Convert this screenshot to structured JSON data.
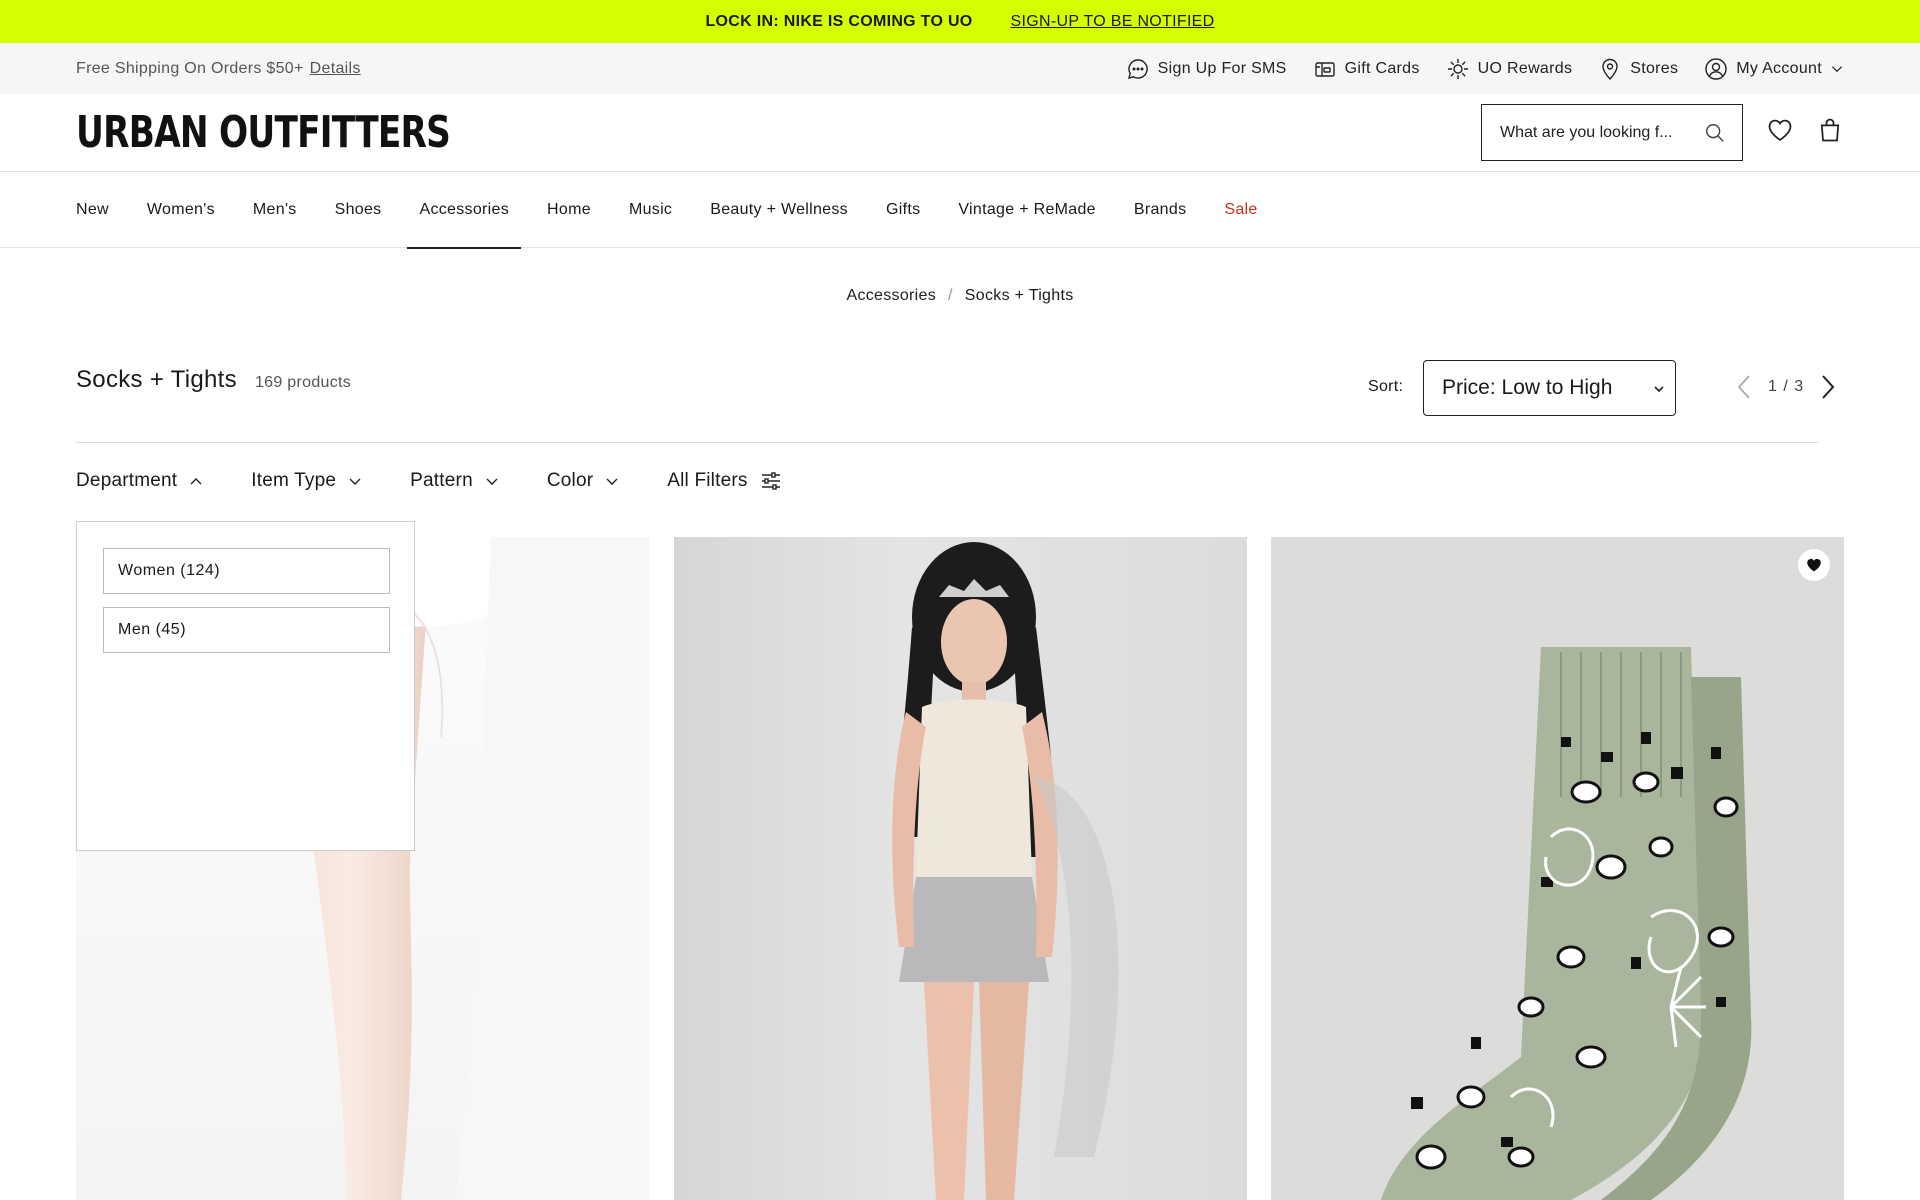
{
  "promo": {
    "headline": "LOCK IN: NIKE IS COMING TO UO",
    "link": "SIGN-UP TO BE NOTIFIED",
    "background": "#d5ff00"
  },
  "utility": {
    "shipping_text": "Free Shipping On Orders $50+",
    "details_link": "Details",
    "links": [
      {
        "label": "Sign Up For SMS",
        "icon": "chat-bubble-icon"
      },
      {
        "label": "Gift Cards",
        "icon": "gift-card-icon"
      },
      {
        "label": "UO Rewards",
        "icon": "sparkle-icon"
      },
      {
        "label": "Stores",
        "icon": "location-pin-icon"
      },
      {
        "label": "My Account",
        "icon": "user-circle-icon"
      }
    ]
  },
  "header": {
    "logo": "URBAN OUTFITTERS",
    "search_placeholder": "What are you looking f...",
    "icons": [
      "heart-icon",
      "bag-icon"
    ]
  },
  "nav": {
    "items": [
      "New",
      "Women's",
      "Men's",
      "Shoes",
      "Accessories",
      "Home",
      "Music",
      "Beauty + Wellness",
      "Gifts",
      "Vintage + ReMade",
      "Brands",
      "Sale"
    ],
    "active": "Accessories",
    "sale_color": "#c8321b"
  },
  "breadcrumb": {
    "items": [
      "Accessories",
      "Socks + Tights"
    ],
    "separator": "/"
  },
  "listing": {
    "title": "Socks + Tights",
    "count": "169 products",
    "sort_label": "Sort:",
    "sort_value": "Price: Low to High",
    "page_current": "1",
    "page_sep": "/",
    "page_total": "3"
  },
  "filters": {
    "items": [
      "Department",
      "Item Type",
      "Pattern",
      "Color",
      "All Filters"
    ],
    "open": "Department"
  },
  "department_dropdown": {
    "options": [
      "Women (124)",
      "Men (45)"
    ]
  }
}
